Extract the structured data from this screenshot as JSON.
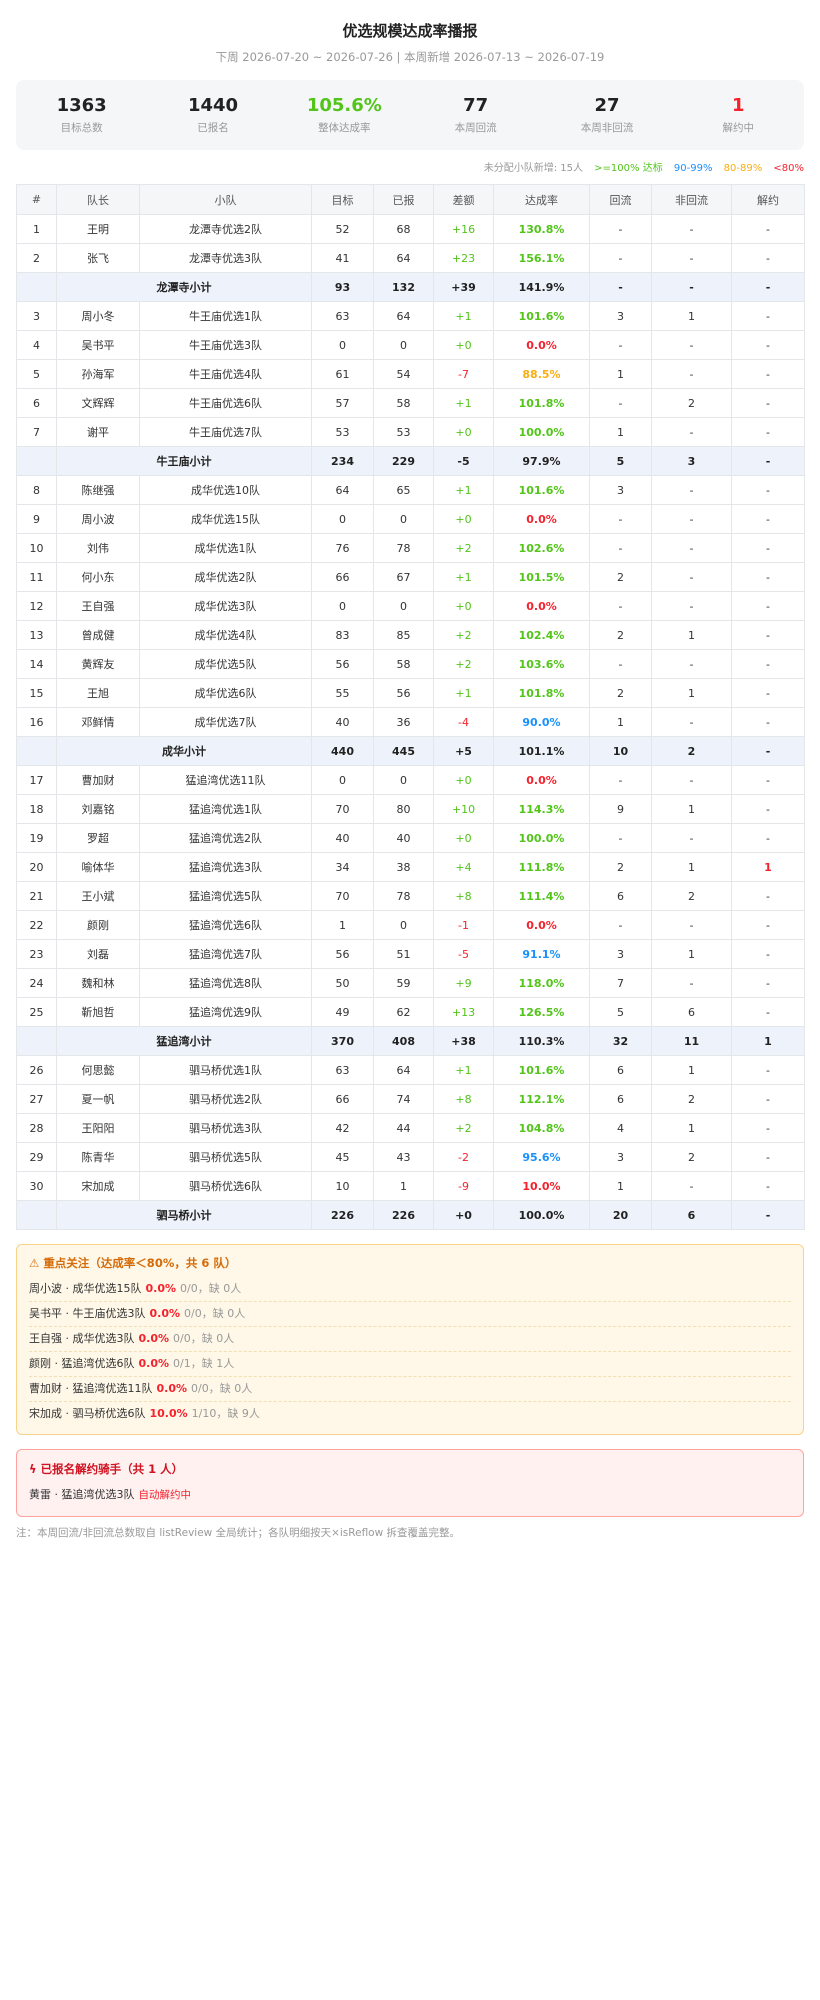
{
  "header": {
    "title": "优选规模达成率播报",
    "subtitle": "下周 2026-07-20 ~ 2026-07-26 | 本周新增 2026-07-13 ~ 2026-07-19"
  },
  "stats": [
    {
      "value": "1363",
      "label": "目标总数",
      "color": "#222222"
    },
    {
      "value": "1440",
      "label": "已报名",
      "color": "#222222"
    },
    {
      "value": "105.6%",
      "label": "整体达成率",
      "color": "#52c41a"
    },
    {
      "value": "77",
      "label": "本周回流",
      "color": "#222222"
    },
    {
      "value": "27",
      "label": "本周非回流",
      "color": "#222222"
    },
    {
      "value": "1",
      "label": "解约中",
      "color": "#f5222d"
    }
  ],
  "legend": {
    "unassigned": "未分配小队新增: 15人",
    "green": ">=100% 达标",
    "blue": "90-99%",
    "orange": "80-89%",
    "red": "<80%",
    "colors": {
      "green": "#52c41a",
      "blue": "#1890ff",
      "orange": "#faad14",
      "red": "#f5222d"
    }
  },
  "table": {
    "headers": [
      "#",
      "队长",
      "小队",
      "目标",
      "已报",
      "差额",
      "达成率",
      "回流",
      "非回流",
      "解约"
    ],
    "rows": [
      {
        "type": "row",
        "cells": [
          "1",
          "王明",
          "龙潭寺优选2队",
          "52",
          "68",
          "+16",
          "130.8%",
          "-",
          "-",
          "-"
        ],
        "rate": "green",
        "diff": "pos"
      },
      {
        "type": "row",
        "cells": [
          "2",
          "张飞",
          "龙潭寺优选3队",
          "41",
          "64",
          "+23",
          "156.1%",
          "-",
          "-",
          "-"
        ],
        "rate": "green",
        "diff": "pos"
      },
      {
        "type": "subtotal",
        "label": "龙潭寺小计",
        "cells": [
          "93",
          "132",
          "+39",
          "141.9%",
          "-",
          "-",
          "-"
        ],
        "rate": "green",
        "diff": "pos"
      },
      {
        "type": "row",
        "cells": [
          "3",
          "周小冬",
          "牛王庙优选1队",
          "63",
          "64",
          "+1",
          "101.6%",
          "3",
          "1",
          "-"
        ],
        "rate": "green",
        "diff": "pos"
      },
      {
        "type": "row",
        "cells": [
          "4",
          "吴书平",
          "牛王庙优选3队",
          "0",
          "0",
          "+0",
          "0.0%",
          "-",
          "-",
          "-"
        ],
        "rate": "red",
        "diff": "pos"
      },
      {
        "type": "row",
        "cells": [
          "5",
          "孙海军",
          "牛王庙优选4队",
          "61",
          "54",
          "-7",
          "88.5%",
          "1",
          "-",
          "-"
        ],
        "rate": "orange",
        "diff": "neg"
      },
      {
        "type": "row",
        "cells": [
          "6",
          "文辉辉",
          "牛王庙优选6队",
          "57",
          "58",
          "+1",
          "101.8%",
          "-",
          "2",
          "-"
        ],
        "rate": "green",
        "diff": "pos"
      },
      {
        "type": "row",
        "cells": [
          "7",
          "谢平",
          "牛王庙优选7队",
          "53",
          "53",
          "+0",
          "100.0%",
          "1",
          "-",
          "-"
        ],
        "rate": "green",
        "diff": "pos"
      },
      {
        "type": "subtotal",
        "label": "牛王庙小计",
        "cells": [
          "234",
          "229",
          "-5",
          "97.9%",
          "5",
          "3",
          "-"
        ],
        "rate": "blue",
        "diff": "neg"
      },
      {
        "type": "row",
        "cells": [
          "8",
          "陈继强",
          "成华优选10队",
          "64",
          "65",
          "+1",
          "101.6%",
          "3",
          "-",
          "-"
        ],
        "rate": "green",
        "diff": "pos"
      },
      {
        "type": "row",
        "cells": [
          "9",
          "周小波",
          "成华优选15队",
          "0",
          "0",
          "+0",
          "0.0%",
          "-",
          "-",
          "-"
        ],
        "rate": "red",
        "diff": "pos"
      },
      {
        "type": "row",
        "cells": [
          "10",
          "刘伟",
          "成华优选1队",
          "76",
          "78",
          "+2",
          "102.6%",
          "-",
          "-",
          "-"
        ],
        "rate": "green",
        "diff": "pos"
      },
      {
        "type": "row",
        "cells": [
          "11",
          "何小东",
          "成华优选2队",
          "66",
          "67",
          "+1",
          "101.5%",
          "2",
          "-",
          "-"
        ],
        "rate": "green",
        "diff": "pos"
      },
      {
        "type": "row",
        "cells": [
          "12",
          "王自强",
          "成华优选3队",
          "0",
          "0",
          "+0",
          "0.0%",
          "-",
          "-",
          "-"
        ],
        "rate": "red",
        "diff": "pos"
      },
      {
        "type": "row",
        "cells": [
          "13",
          "曾成健",
          "成华优选4队",
          "83",
          "85",
          "+2",
          "102.4%",
          "2",
          "1",
          "-"
        ],
        "rate": "green",
        "diff": "pos"
      },
      {
        "type": "row",
        "cells": [
          "14",
          "黄辉友",
          "成华优选5队",
          "56",
          "58",
          "+2",
          "103.6%",
          "-",
          "-",
          "-"
        ],
        "rate": "green",
        "diff": "pos"
      },
      {
        "type": "row",
        "cells": [
          "15",
          "王旭",
          "成华优选6队",
          "55",
          "56",
          "+1",
          "101.8%",
          "2",
          "1",
          "-"
        ],
        "rate": "green",
        "diff": "pos"
      },
      {
        "type": "row",
        "cells": [
          "16",
          "邓鲜情",
          "成华优选7队",
          "40",
          "36",
          "-4",
          "90.0%",
          "1",
          "-",
          "-"
        ],
        "rate": "blue",
        "diff": "neg"
      },
      {
        "type": "subtotal",
        "label": "成华小计",
        "cells": [
          "440",
          "445",
          "+5",
          "101.1%",
          "10",
          "2",
          "-"
        ],
        "rate": "green",
        "diff": "pos"
      },
      {
        "type": "row",
        "cells": [
          "17",
          "曹加财",
          "猛追湾优选11队",
          "0",
          "0",
          "+0",
          "0.0%",
          "-",
          "-",
          "-"
        ],
        "rate": "red",
        "diff": "pos"
      },
      {
        "type": "row",
        "cells": [
          "18",
          "刘嘉铭",
          "猛追湾优选1队",
          "70",
          "80",
          "+10",
          "114.3%",
          "9",
          "1",
          "-"
        ],
        "rate": "green",
        "diff": "pos"
      },
      {
        "type": "row",
        "cells": [
          "19",
          "罗超",
          "猛追湾优选2队",
          "40",
          "40",
          "+0",
          "100.0%",
          "-",
          "-",
          "-"
        ],
        "rate": "green",
        "diff": "pos"
      },
      {
        "type": "row",
        "cells": [
          "20",
          "喻体华",
          "猛追湾优选3队",
          "34",
          "38",
          "+4",
          "111.8%",
          "2",
          "1",
          "1"
        ],
        "rate": "green",
        "diff": "pos",
        "terminate": true
      },
      {
        "type": "row",
        "cells": [
          "21",
          "王小斌",
          "猛追湾优选5队",
          "70",
          "78",
          "+8",
          "111.4%",
          "6",
          "2",
          "-"
        ],
        "rate": "green",
        "diff": "pos"
      },
      {
        "type": "row",
        "cells": [
          "22",
          "颜刚",
          "猛追湾优选6队",
          "1",
          "0",
          "-1",
          "0.0%",
          "-",
          "-",
          "-"
        ],
        "rate": "red",
        "diff": "neg"
      },
      {
        "type": "row",
        "cells": [
          "23",
          "刘磊",
          "猛追湾优选7队",
          "56",
          "51",
          "-5",
          "91.1%",
          "3",
          "1",
          "-"
        ],
        "rate": "blue",
        "diff": "neg"
      },
      {
        "type": "row",
        "cells": [
          "24",
          "魏和林",
          "猛追湾优选8队",
          "50",
          "59",
          "+9",
          "118.0%",
          "7",
          "-",
          "-"
        ],
        "rate": "green",
        "diff": "pos"
      },
      {
        "type": "row",
        "cells": [
          "25",
          "靳旭哲",
          "猛追湾优选9队",
          "49",
          "62",
          "+13",
          "126.5%",
          "5",
          "6",
          "-"
        ],
        "rate": "green",
        "diff": "pos"
      },
      {
        "type": "subtotal",
        "label": "猛追湾小计",
        "cells": [
          "370",
          "408",
          "+38",
          "110.3%",
          "32",
          "11",
          "1"
        ],
        "rate": "green",
        "diff": "pos"
      },
      {
        "type": "row",
        "cells": [
          "26",
          "何思懿",
          "驷马桥优选1队",
          "63",
          "64",
          "+1",
          "101.6%",
          "6",
          "1",
          "-"
        ],
        "rate": "green",
        "diff": "pos"
      },
      {
        "type": "row",
        "cells": [
          "27",
          "夏一帆",
          "驷马桥优选2队",
          "66",
          "74",
          "+8",
          "112.1%",
          "6",
          "2",
          "-"
        ],
        "rate": "green",
        "diff": "pos"
      },
      {
        "type": "row",
        "cells": [
          "28",
          "王阳阳",
          "驷马桥优选3队",
          "42",
          "44",
          "+2",
          "104.8%",
          "4",
          "1",
          "-"
        ],
        "rate": "green",
        "diff": "pos"
      },
      {
        "type": "row",
        "cells": [
          "29",
          "陈青华",
          "驷马桥优选5队",
          "45",
          "43",
          "-2",
          "95.6%",
          "3",
          "2",
          "-"
        ],
        "rate": "blue",
        "diff": "neg"
      },
      {
        "type": "row",
        "cells": [
          "30",
          "宋加成",
          "驷马桥优选6队",
          "10",
          "1",
          "-9",
          "10.0%",
          "1",
          "-",
          "-"
        ],
        "rate": "red",
        "diff": "neg"
      },
      {
        "type": "subtotal",
        "label": "驷马桥小计",
        "cells": [
          "226",
          "226",
          "+0",
          "100.0%",
          "20",
          "6",
          "-"
        ],
        "rate": "green",
        "diff": "pos"
      }
    ]
  },
  "focus": {
    "icon": "warning-icon",
    "title": "重点关注（达成率＜80%，共 6 队）",
    "items": [
      {
        "name": "周小波 · 成华优选15队",
        "rate": "0.0%",
        "detail": "0/0，缺 0人"
      },
      {
        "name": "吴书平 · 牛王庙优选3队",
        "rate": "0.0%",
        "detail": "0/0，缺 0人"
      },
      {
        "name": "王自强 · 成华优选3队",
        "rate": "0.0%",
        "detail": "0/0，缺 0人"
      },
      {
        "name": "颜刚 · 猛追湾优选6队",
        "rate": "0.0%",
        "detail": "0/1，缺 1人"
      },
      {
        "name": "曹加财 · 猛追湾优选11队",
        "rate": "0.0%",
        "detail": "0/0，缺 0人"
      },
      {
        "name": "宋加成 · 驷马桥优选6队",
        "rate": "10.0%",
        "detail": "1/10，缺 9人"
      }
    ]
  },
  "termination": {
    "icon": "lightning-icon",
    "title": "已报名解约骑手（共 1 人）",
    "items": [
      {
        "name": "黄雷 · 猛追湾优选3队",
        "status": "自动解约中"
      }
    ]
  },
  "note": "注：本周回流/非回流总数取自 listReview 全局统计；各队明细按天×isReflow 拆查覆盖完整。"
}
